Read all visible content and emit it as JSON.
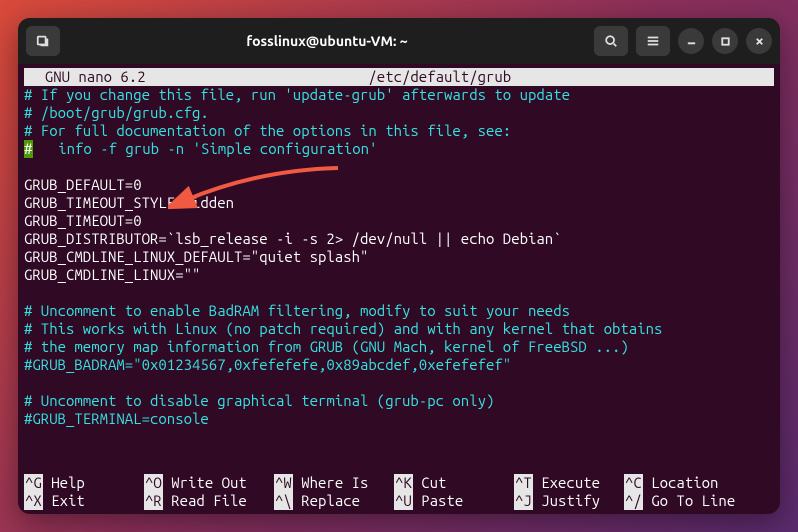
{
  "window": {
    "title": "fosslinux@ubuntu-VM: ~"
  },
  "nano": {
    "app_label": "  GNU nano 6.2",
    "file_path": "/etc/default/grub"
  },
  "lines": [
    {
      "cls": "comment",
      "prefix": "#",
      "text": " If you change this file, run 'update-grub' afterwards to update"
    },
    {
      "cls": "comment",
      "prefix": "#",
      "text": " /boot/grub/grub.cfg."
    },
    {
      "cls": "comment",
      "prefix": "#",
      "text": " For full documentation of the options in this file, see:"
    },
    {
      "cls": "comment",
      "prefix": "#",
      "text": "   info -f grub -n 'Simple configuration'",
      "cursor": true
    },
    {
      "cls": "",
      "text": ""
    },
    {
      "cls": "",
      "text": "GRUB_DEFAULT=0"
    },
    {
      "cls": "",
      "text": "GRUB_TIMEOUT_STYLE=hidden"
    },
    {
      "cls": "",
      "text": "GRUB_TIMEOUT=0"
    },
    {
      "cls": "",
      "text": "GRUB_DISTRIBUTOR=`lsb_release -i -s 2> /dev/null || echo Debian`"
    },
    {
      "cls": "",
      "text": "GRUB_CMDLINE_LINUX_DEFAULT=\"quiet splash\""
    },
    {
      "cls": "",
      "text": "GRUB_CMDLINE_LINUX=\"\""
    },
    {
      "cls": "",
      "text": ""
    },
    {
      "cls": "comment",
      "prefix": "#",
      "text": " Uncomment to enable BadRAM filtering, modify to suit your needs"
    },
    {
      "cls": "comment",
      "prefix": "#",
      "text": " This works with Linux (no patch required) and with any kernel that obtains"
    },
    {
      "cls": "comment",
      "prefix": "#",
      "text": " the memory map information from GRUB (GNU Mach, kernel of FreeBSD ...)"
    },
    {
      "cls": "comment",
      "prefix": "#",
      "text": "GRUB_BADRAM=\"0x01234567,0xfefefefe,0x89abcdef,0xefefefef\""
    },
    {
      "cls": "",
      "text": ""
    },
    {
      "cls": "comment",
      "prefix": "#",
      "text": " Uncomment to disable graphical terminal (grub-pc only)"
    },
    {
      "cls": "comment",
      "prefix": "#",
      "text": "GRUB_TERMINAL=console"
    }
  ],
  "shortcuts": {
    "row1": [
      {
        "key": "^G",
        "label": "Help"
      },
      {
        "key": "^O",
        "label": "Write Out"
      },
      {
        "key": "^W",
        "label": "Where Is"
      },
      {
        "key": "^K",
        "label": "Cut"
      },
      {
        "key": "^T",
        "label": "Execute"
      },
      {
        "key": "^C",
        "label": "Location"
      }
    ],
    "row2": [
      {
        "key": "^X",
        "label": "Exit"
      },
      {
        "key": "^R",
        "label": "Read File"
      },
      {
        "key": "^\\",
        "label": "Replace"
      },
      {
        "key": "^U",
        "label": "Paste"
      },
      {
        "key": "^J",
        "label": "Justify"
      },
      {
        "key": "^/",
        "label": "Go To Line"
      }
    ]
  }
}
